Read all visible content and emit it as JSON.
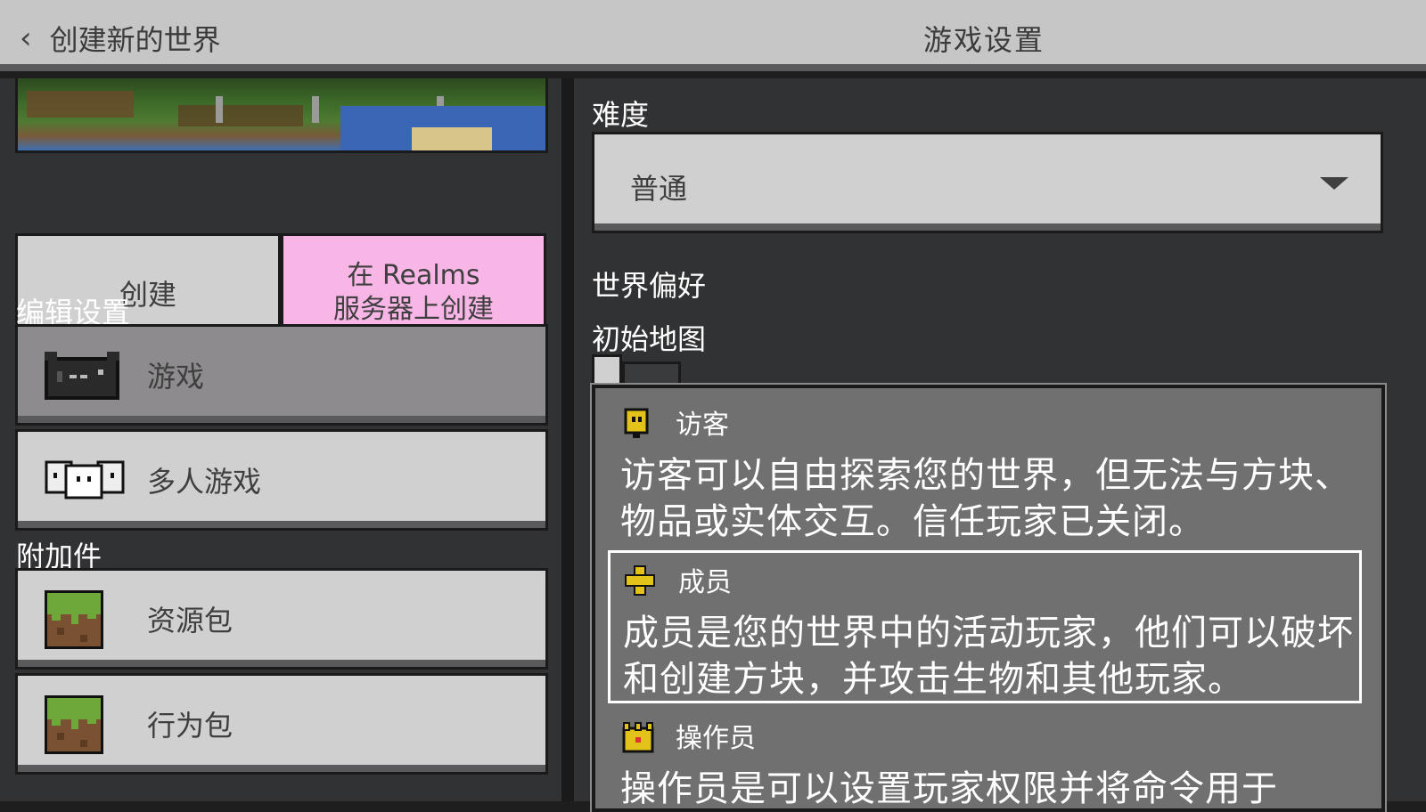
{
  "header": {
    "back_label": "创建新的世界",
    "title": "游戏设置"
  },
  "left": {
    "create_label": "创建",
    "realms_line1": "在 Realms",
    "realms_line2": "服务器上创建",
    "edit_settings_heading": "编辑设置",
    "nav": [
      {
        "label": "游戏",
        "icon": "controller-icon",
        "active": true
      },
      {
        "label": "多人游戏",
        "icon": "multiplayer-icon",
        "active": false
      }
    ],
    "addons_heading": "附加件",
    "packs": [
      {
        "label": "资源包",
        "icon": "grass-block-icon"
      },
      {
        "label": "行为包",
        "icon": "grass-block-icon"
      }
    ]
  },
  "right": {
    "difficulty_label": "难度",
    "difficulty_value": "普通",
    "world_prefs_label": "世界偏好",
    "starting_map_label": "初始地图",
    "permissions": [
      {
        "title": "访客",
        "desc": "访客可以自由探索您的世界，但无法与方块、物品或实体交互。信任玩家已关闭。",
        "icon": "visitor-icon",
        "selected": false
      },
      {
        "title": "成员",
        "desc": "成员是您的世界中的活动玩家，他们可以破坏和创建方块，并攻击生物和其他玩家。",
        "icon": "member-icon",
        "selected": true
      },
      {
        "title": "操作员",
        "desc": "操作员是可以设置玩家权限并将命令用于",
        "icon": "operator-icon",
        "selected": false
      }
    ]
  },
  "colors": {
    "realms_pink": "#f7b6e6",
    "panel_dark": "#313233",
    "button_gray": "#d0d0d0",
    "active_gray": "#8d8b8d",
    "popup_gray": "#6f706f"
  }
}
